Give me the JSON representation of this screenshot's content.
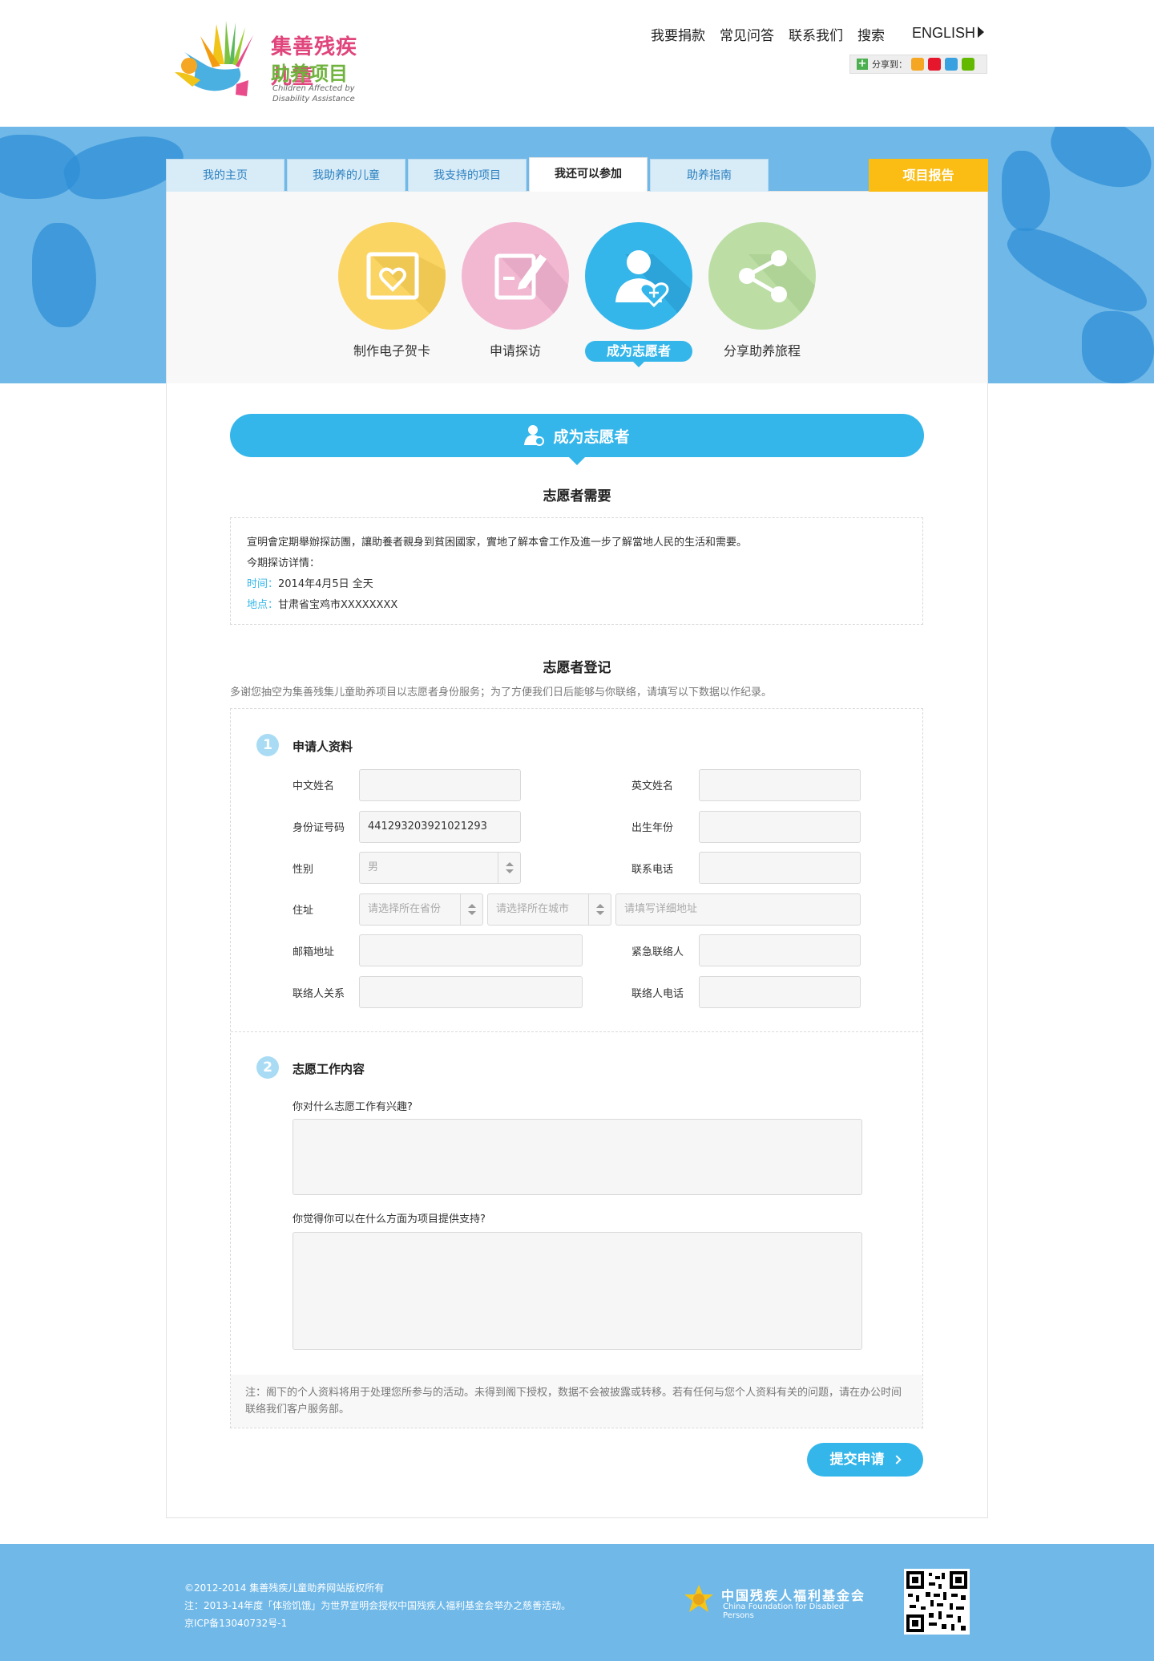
{
  "header": {
    "logo": {
      "cn_line1": "集善残疾儿童",
      "cn_line2": "助养项目",
      "en": "Children Affected by Disability Assistance"
    },
    "nav": [
      "我要捐款",
      "常见问答",
      "联系我们",
      "搜索"
    ],
    "lang": "ENGLISH",
    "share_label": "分享到："
  },
  "tabs": {
    "items": [
      "我的主页",
      "我助养的儿童",
      "我支持的项目",
      "我还可以参加",
      "助养指南"
    ],
    "report": "项目报告"
  },
  "actions": [
    "制作电子贺卡",
    "申请探访",
    "成为志愿者",
    "分享助养旅程"
  ],
  "section_title": "成为志愿者",
  "need": {
    "title": "志愿者需要",
    "desc": "宣明會定期舉辦探訪團，讓助養者親身到貧困國家，實地了解本會工作及進一步了解當地人民的生活和需要。",
    "detail_label": "今期探访详情：",
    "time_key": "时间：",
    "time_val": "2014年4月5日 全天",
    "place_key": "地点：",
    "place_val": "甘肃省宝鸡市XXXXXXXX"
  },
  "register": {
    "title": "志愿者登记",
    "desc": "多谢您抽空为集善残集儿童助养项目以志愿者身份服务；为了方便我们日后能够与你联络，请填写以下数据以作纪录。"
  },
  "form": {
    "step1": {
      "num": "1",
      "title": "申请人资料"
    },
    "labels": {
      "cn_name": "中文姓名",
      "en_name": "英文姓名",
      "id_no": "身份证号码",
      "birth": "出生年份",
      "gender": "性别",
      "phone": "联系电话",
      "address": "住址",
      "email": "邮箱地址",
      "emergency": "紧急联络人",
      "relation": "联络人关系",
      "contact_phone": "联络人电话"
    },
    "values": {
      "id_no": "441293203921021293",
      "gender": "男"
    },
    "placeholders": {
      "province": "请选择所在省份",
      "city": "请选择所在城市",
      "detail": "请填写详细地址"
    },
    "step2": {
      "num": "2",
      "title": "志愿工作内容"
    },
    "q1": "你对什么志愿工作有兴趣?",
    "q2": "你觉得你可以在什么方面为项目提供支持?",
    "note": "注：阁下的个人资料将用于处理您所参与的活动。未得到阁下授权，数据不会被披露或转移。若有任何与您个人资料有关的问题，请在办公时间联络我们客户服务部。",
    "submit": "提交申请"
  },
  "footer": {
    "copyright": "©2012-2014 集善残疾儿童助养网站版权所有",
    "note": "注：2013-14年度「体验饥饿」为世界宣明会授权中国残疾人福利基金会举办之慈善活动。",
    "icp": "京ICP备13040732号-1",
    "org_cn": "中国残疾人福利基金会",
    "org_en": "China Foundation for Disabled Persons"
  },
  "colors": {
    "primary": "#35b6ea",
    "banner": "#6fb8e8",
    "report": "#fbbd14",
    "tab": "#d8ecf8"
  }
}
